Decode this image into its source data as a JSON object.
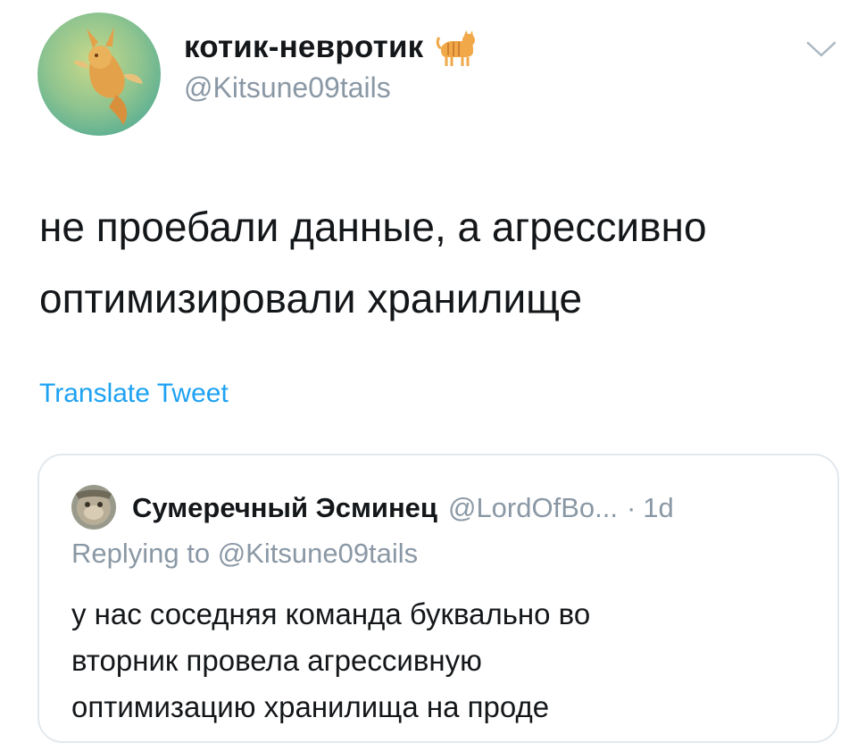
{
  "tweet": {
    "display_name": "котик-невротик",
    "name_emoji": "cat-emoji",
    "handle": "@Kitsune09tails",
    "text_line1": "не проебали данные, а агрессивно",
    "text_line2": "оптимизировали хранилище",
    "translate_label": "Translate Tweet",
    "avatar_icon": "fox-avatar",
    "menu_icon": "chevron-down-icon"
  },
  "quoted": {
    "display_name": "Сумеречный Эсминец",
    "handle": "@LordOfBo...",
    "separator": "·",
    "time": "1d",
    "replying_to": "Replying to @Kitsune09tails",
    "text_line1": "у нас соседняя команда буквально во",
    "text_line2": "вторник провела агрессивную",
    "text_line3": "оптимизацию хранилища на проде",
    "avatar_icon": "ape-avatar"
  },
  "colors": {
    "link": "#1da1f2",
    "secondary_text": "#8a98a5",
    "primary_text": "#14171a",
    "border": "#e1e8ed",
    "avatar_bg": "#64b48e"
  }
}
